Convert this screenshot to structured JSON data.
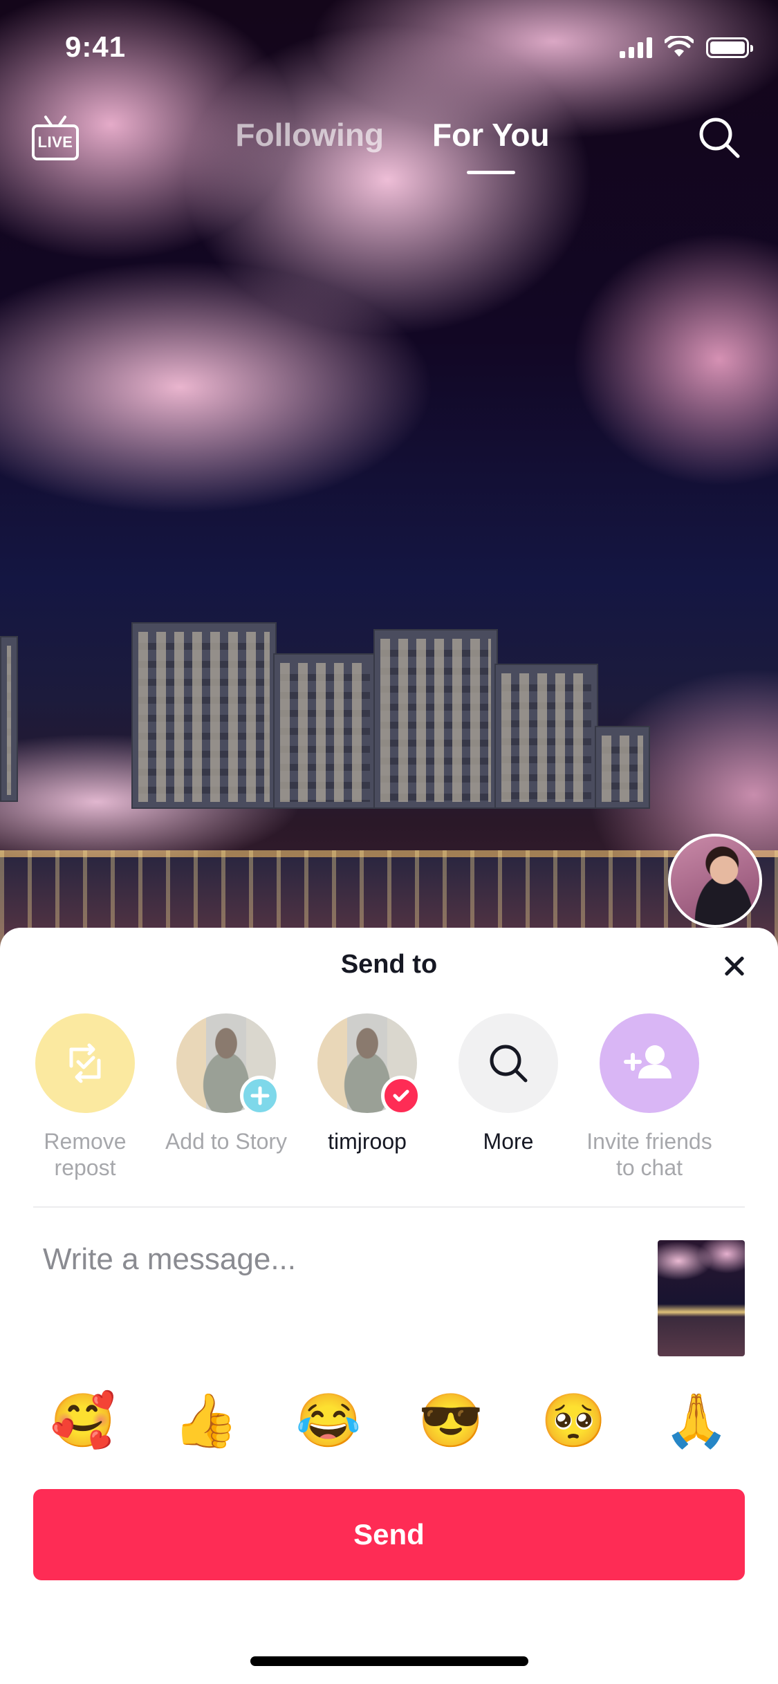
{
  "status_bar": {
    "time": "9:41"
  },
  "top_nav": {
    "live_label": "LIVE",
    "tabs": [
      {
        "label": "Following",
        "active": false
      },
      {
        "label": "For You",
        "active": true
      }
    ]
  },
  "sheet": {
    "title": "Send to",
    "targets": [
      {
        "label": "Remove repost",
        "icon": "repost-icon"
      },
      {
        "label": "Add to Story",
        "icon": "avatar-add-icon"
      },
      {
        "label": "timjroop",
        "icon": "avatar-check-icon"
      },
      {
        "label": "More",
        "icon": "search-icon"
      },
      {
        "label": "Invite friends to chat",
        "icon": "add-person-icon"
      }
    ],
    "message_placeholder": "Write a message...",
    "emojis": [
      "🥰",
      "👍",
      "😂",
      "😎",
      "🥺",
      "🙏"
    ],
    "send_label": "Send"
  },
  "colors": {
    "accent": "#fe2c55",
    "repost_bg": "#fbe9a0",
    "invite_bg": "#d9b6f5",
    "more_bg": "#f1f1f2"
  }
}
